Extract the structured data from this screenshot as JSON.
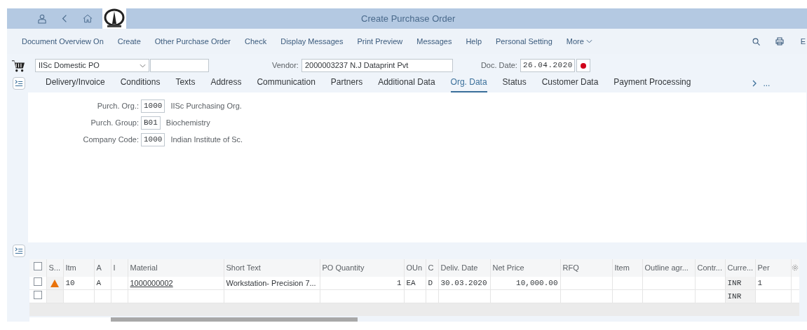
{
  "header": {
    "title": "Create Purchase Order"
  },
  "toolbar": {
    "items": [
      "Document Overview On",
      "Create",
      "Other Purchase Order",
      "Check",
      "Display Messages",
      "Print Preview",
      "Messages",
      "Help",
      "Personal Setting"
    ],
    "more": "More",
    "cut_item": "E"
  },
  "po_type": {
    "value": "IISc Domestic PO"
  },
  "vendor": {
    "label": "Vendor:",
    "value": "2000003237 N.J Dataprint Pvt"
  },
  "doc_date": {
    "label": "Doc. Date:",
    "value": "26.04.2020"
  },
  "tabs": [
    {
      "label": "Delivery/Invoice",
      "selected": false
    },
    {
      "label": "Conditions",
      "selected": false
    },
    {
      "label": "Texts",
      "selected": false
    },
    {
      "label": "Address",
      "selected": false
    },
    {
      "label": "Communication",
      "selected": false
    },
    {
      "label": "Partners",
      "selected": false
    },
    {
      "label": "Additional Data",
      "selected": false
    },
    {
      "label": "Org. Data",
      "selected": true
    },
    {
      "label": "Status",
      "selected": false
    },
    {
      "label": "Customer Data",
      "selected": false
    },
    {
      "label": "Payment Processing",
      "selected": false
    }
  ],
  "tabs_overflow": "...",
  "org_fields": [
    {
      "label": "Purch. Org.:",
      "value": "1000",
      "description": "IISc Purchasing Org."
    },
    {
      "label": "Purch. Group:",
      "value": "B01",
      "description": "Biochemistry"
    },
    {
      "label": "Company Code:",
      "value": "1000",
      "description": "Indian Institute of Sc."
    }
  ],
  "items_table": {
    "select_all": {
      "checked": false
    },
    "columns": [
      "S...",
      "Itm",
      "A",
      "I",
      "Material",
      "Short Text",
      "PO Quantity",
      "OUn",
      "C",
      "Deliv. Date",
      "Net Price",
      "RFQ",
      "Item",
      "Outline agr...",
      "Contr...",
      "Curre...",
      "Per"
    ],
    "rows": [
      {
        "checked": false,
        "warning": true,
        "itm": "10",
        "a": "A",
        "material": "1000000002",
        "short_text": "Workstation- Precision 7...",
        "po_quantity": "1",
        "oun": "EA",
        "c": "D",
        "deliv_date": "30.03.2020",
        "net_price": "10,000.00",
        "curre": "INR",
        "per": "1"
      },
      {
        "checked": false,
        "warning": false,
        "curre": "INR"
      }
    ]
  }
}
